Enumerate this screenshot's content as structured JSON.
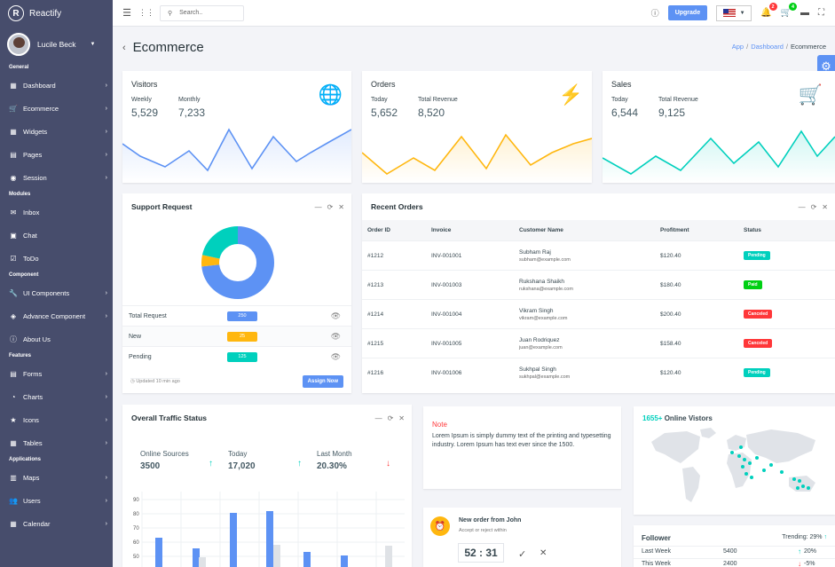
{
  "app": {
    "name": "Reactify"
  },
  "user": {
    "name": "Lucile Beck"
  },
  "sidebar": {
    "groups": [
      {
        "label": "General",
        "items": [
          {
            "label": "Dashboard",
            "icon": "dashboard-icon",
            "glyph": "▦",
            "arrow": true
          },
          {
            "label": "Ecommerce",
            "icon": "cart-icon",
            "glyph": "🛒",
            "arrow": true
          },
          {
            "label": "Widgets",
            "icon": "widgets-icon",
            "glyph": "▦",
            "arrow": true
          },
          {
            "label": "Pages",
            "icon": "pages-icon",
            "glyph": "▤",
            "arrow": true
          },
          {
            "label": "Session",
            "icon": "session-icon",
            "glyph": "◉",
            "arrow": true
          }
        ]
      },
      {
        "label": "Modules",
        "items": [
          {
            "label": "Inbox",
            "icon": "inbox-icon",
            "glyph": "✉",
            "arrow": false
          },
          {
            "label": "Chat",
            "icon": "chat-icon",
            "glyph": "▣",
            "arrow": false
          },
          {
            "label": "ToDo",
            "icon": "todo-icon",
            "glyph": "☑",
            "arrow": false
          }
        ]
      },
      {
        "label": "Component",
        "items": [
          {
            "label": "UI Components",
            "icon": "wrench-icon",
            "glyph": "🔧",
            "arrow": true
          },
          {
            "label": "Advance Component",
            "icon": "component-icon",
            "glyph": "◈",
            "arrow": true
          },
          {
            "label": "About Us",
            "icon": "info-icon",
            "glyph": "ⓘ",
            "arrow": false
          }
        ]
      },
      {
        "label": "Features",
        "items": [
          {
            "label": "Forms",
            "icon": "forms-icon",
            "glyph": "▤",
            "arrow": true
          },
          {
            "label": "Charts",
            "icon": "charts-icon",
            "glyph": "◔",
            "arrow": true
          },
          {
            "label": "Icons",
            "icon": "star-icon",
            "glyph": "★",
            "arrow": true
          },
          {
            "label": "Tables",
            "icon": "tables-icon",
            "glyph": "▦",
            "arrow": true
          }
        ]
      },
      {
        "label": "Applications",
        "items": [
          {
            "label": "Maps",
            "icon": "map-icon",
            "glyph": "▥",
            "arrow": true
          },
          {
            "label": "Users",
            "icon": "users-icon",
            "glyph": "👥",
            "arrow": true
          },
          {
            "label": "Calendar",
            "icon": "calendar-icon",
            "glyph": "▦",
            "arrow": true
          }
        ]
      }
    ]
  },
  "topbar": {
    "search_placeholder": "Search..",
    "upgrade_label": "Upgrade",
    "notif_count": "2",
    "cart_count": "4"
  },
  "page": {
    "title": "Ecommerce",
    "breadcrumb": [
      "App",
      "Dashboard",
      "Ecommerce"
    ]
  },
  "visitors": {
    "title": "Visitors",
    "labels": [
      "Weekly",
      "Monthly"
    ],
    "values": [
      "5,529",
      "7,233"
    ]
  },
  "orders_stat": {
    "title": "Orders",
    "labels": [
      "Today",
      "Total Revenue"
    ],
    "values": [
      "5,652",
      "8,520"
    ]
  },
  "sales": {
    "title": "Sales",
    "labels": [
      "Today",
      "Total Revenue"
    ],
    "values": [
      "6,544",
      "9,125"
    ]
  },
  "colors": {
    "blue": "#5d92f4",
    "orange": "#ffb70f",
    "teal": "#00d0bd",
    "red": "#ff3739",
    "green": "#00d014"
  },
  "support": {
    "title": "Support Request",
    "rows": [
      {
        "name": "Total Request",
        "value": "250",
        "color": "#5d92f4"
      },
      {
        "name": "New",
        "value": "25",
        "color": "#ffb70f"
      },
      {
        "name": "Pending",
        "value": "125",
        "color": "#00d0bd"
      }
    ],
    "updated": "Updated 10 min ago",
    "assign_label": "Assign Now"
  },
  "recent_orders": {
    "title": "Recent Orders",
    "headers": [
      "Order ID",
      "Invoice",
      "Customer Name",
      "Profitment",
      "Status"
    ],
    "rows": [
      {
        "id": "#1212",
        "invoice": "INV-001001",
        "name": "Subham Raj",
        "email": "subham@example.com",
        "profit": "$120.40",
        "status": "Pending",
        "color": "#00d0bd"
      },
      {
        "id": "#1213",
        "invoice": "INV-001003",
        "name": "Rukshana Shaikh",
        "email": "rukshana@example.com",
        "profit": "$180.40",
        "status": "Paid",
        "color": "#00d014"
      },
      {
        "id": "#1214",
        "invoice": "INV-001004",
        "name": "Vikram Singh",
        "email": "vikram@example.com",
        "profit": "$200.40",
        "status": "Canceled",
        "color": "#ff3739"
      },
      {
        "id": "#1215",
        "invoice": "INV-001005",
        "name": "Juan Rodriquez",
        "email": "juan@example.com",
        "profit": "$158.40",
        "status": "Canceled",
        "color": "#ff3739"
      },
      {
        "id": "#1216",
        "invoice": "INV-001006",
        "name": "Sukhpal Singh",
        "email": "sukhpal@example.com",
        "profit": "$120.40",
        "status": "Pending",
        "color": "#00d0bd"
      }
    ]
  },
  "traffic": {
    "title": "Overall Traffic Status",
    "stats": [
      {
        "label": "Online Sources",
        "value": "3500",
        "trend": "up"
      },
      {
        "label": "Today",
        "value": "17,020",
        "trend": "up"
      },
      {
        "label": "Last Month",
        "value": "20.30%",
        "trend": "down"
      }
    ],
    "yticks": [
      "90",
      "80",
      "70",
      "60",
      "50"
    ]
  },
  "note": {
    "title": "Note",
    "text": "Lorem Ipsum is simply dummy text of the printing and typesetting industry. Lorem Ipsum has text ever since the 1500."
  },
  "new_order": {
    "title": "New order from John",
    "subtitle": "Accept or reject within",
    "timer": "52 : 31"
  },
  "online": {
    "count": "1655+",
    "label": "Online Vistors"
  },
  "follower": {
    "title": "Follower",
    "trending": "Trending: 29%",
    "rows": [
      {
        "period": "Last Week",
        "value": "5400",
        "change": "20%",
        "dir": "up"
      },
      {
        "period": "This Week",
        "value": "2400",
        "change": "-5%",
        "dir": "down"
      }
    ]
  }
}
